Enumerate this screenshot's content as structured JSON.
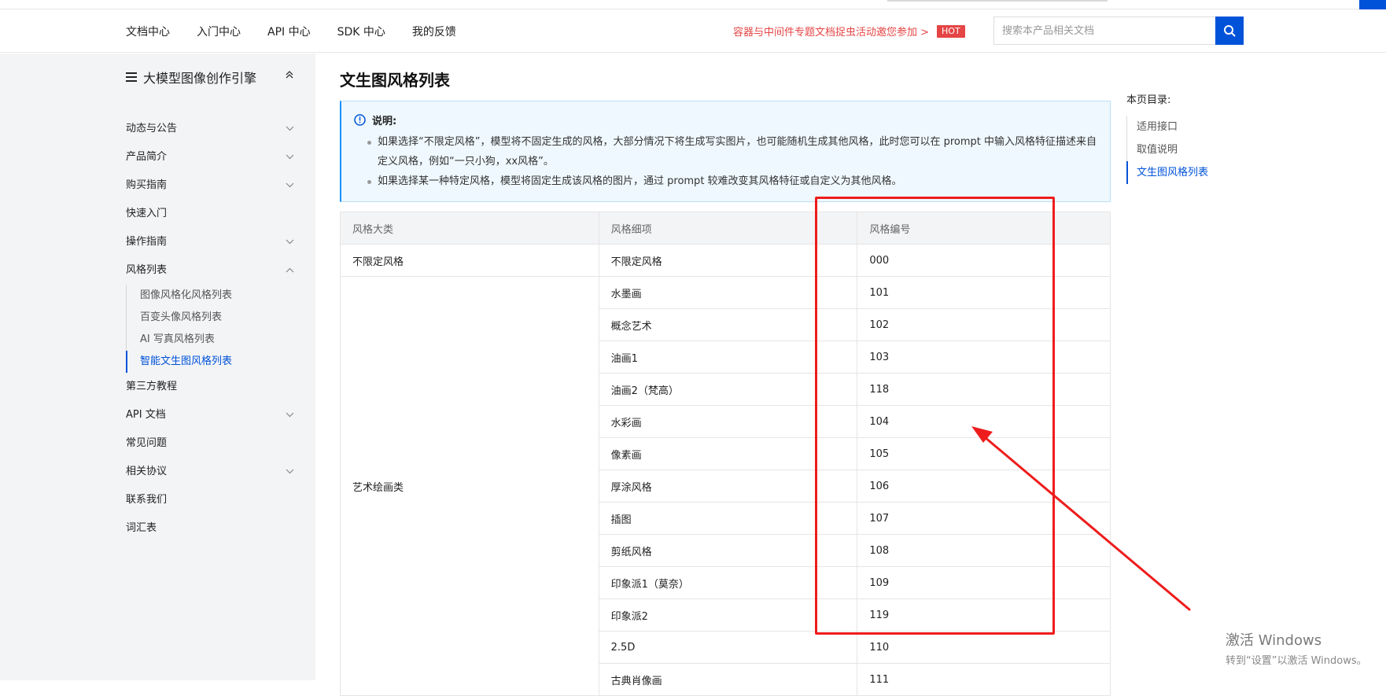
{
  "nav": {
    "links": [
      "文档中心",
      "入门中心",
      "API 中心",
      "SDK 中心",
      "我的反馈"
    ],
    "promo_text": "容器与中间件专题文档捉虫活动邀您参加 >",
    "promo_badge": "HOT",
    "search_placeholder": "搜索本产品相关文档"
  },
  "sidebar": {
    "title": "大模型图像创作引擎",
    "items": [
      {
        "label": "动态与公告",
        "chevron": "down"
      },
      {
        "label": "产品简介",
        "chevron": "down"
      },
      {
        "label": "购买指南",
        "chevron": "down"
      },
      {
        "label": "快速入门",
        "chevron": "none"
      },
      {
        "label": "操作指南",
        "chevron": "down"
      },
      {
        "label": "风格列表",
        "chevron": "up"
      }
    ],
    "subitems": [
      "图像风格化风格列表",
      "百变头像风格列表",
      "AI 写真风格列表",
      "智能文生图风格列表"
    ],
    "active_subitem": "智能文生图风格列表",
    "items_after": [
      {
        "label": "第三方教程",
        "chevron": "none"
      },
      {
        "label": "API 文档",
        "chevron": "down"
      },
      {
        "label": "常见问题",
        "chevron": "none"
      },
      {
        "label": "相关协议",
        "chevron": "down"
      },
      {
        "label": "联系我们",
        "chevron": "none"
      },
      {
        "label": "词汇表",
        "chevron": "none"
      }
    ]
  },
  "main": {
    "title": "文生图风格列表",
    "note_title": "说明:",
    "note_items": [
      "如果选择“不限定风格”，模型将不固定生成的风格，大部分情况下将生成写实图片，也可能随机生成其他风格，此时您可以在 prompt 中输入风格特征描述来自定义风格，例如“一只小狗，xx风格”。",
      "如果选择某一种特定风格，模型将固定生成该风格的图片，通过 prompt 较难改变其风格特征或自定义为其他风格。"
    ],
    "table": {
      "headers": [
        "风格大类",
        "风格细项",
        "风格编号"
      ],
      "row0": {
        "category": "不限定风格",
        "item": "不限定风格",
        "code": "000"
      },
      "group_category": "艺术绘画类",
      "group_rows": [
        {
          "item": "水墨画",
          "code": "101"
        },
        {
          "item": "概念艺术",
          "code": "102"
        },
        {
          "item": "油画1",
          "code": "103"
        },
        {
          "item": "油画2（梵高）",
          "code": "118"
        },
        {
          "item": "水彩画",
          "code": "104"
        },
        {
          "item": "像素画",
          "code": "105"
        },
        {
          "item": "厚涂风格",
          "code": "106"
        },
        {
          "item": "插图",
          "code": "107"
        },
        {
          "item": "剪纸风格",
          "code": "108"
        },
        {
          "item": "印象派1（莫奈）",
          "code": "109"
        },
        {
          "item": "印象派2",
          "code": "119"
        },
        {
          "item": "2.5D",
          "code": "110"
        },
        {
          "item": "古典肖像画",
          "code": "111"
        }
      ]
    }
  },
  "toc": {
    "title": "本页目录:",
    "items": [
      "适用接口",
      "取值说明",
      "文生图风格列表"
    ],
    "active": "文生图风格列表"
  },
  "annotation": {
    "color": "#ee1c1c"
  },
  "watermark": {
    "line1": "激活 Windows",
    "line2": "转到“设置”以激活 Windows。"
  },
  "colors": {
    "accent": "#0052d9",
    "promo": "#e54545",
    "note_bg": "#eff8fe"
  }
}
